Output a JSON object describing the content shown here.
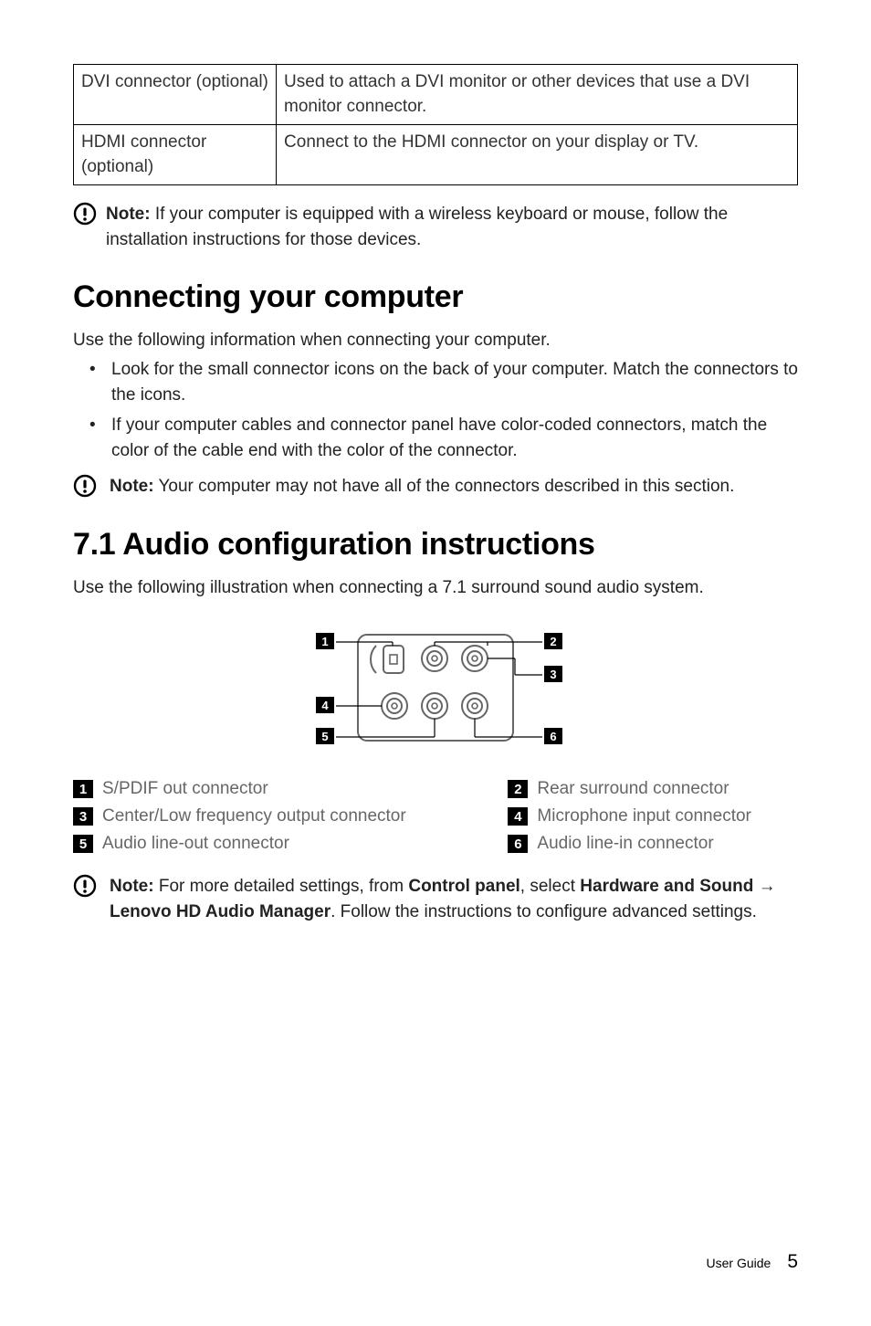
{
  "table": {
    "rows": [
      {
        "c1": "DVI connector (optional)",
        "c2": "Used to attach a DVI monitor or other devices that use a DVI monitor connector."
      },
      {
        "c1": "HDMI connector (optional)",
        "c2": "Connect to the HDMI connector on your display or TV."
      }
    ]
  },
  "notes": {
    "note1": {
      "label": "Note:",
      "body": " If your computer is equipped with a wireless keyboard or mouse, follow the installation instructions for those devices."
    },
    "note2": {
      "label": "Note:",
      "body": " Your computer may not have all of the connectors described in this section."
    },
    "note3": {
      "label": "Note:",
      "body_pre": " For more detailed settings, from ",
      "cp": "Control panel",
      "mid": ", select ",
      "hs": "Hardware and Sound",
      "arrow": " → ",
      "mgr": "Lenovo HD Audio Manager",
      "tail": ". Follow the instructions to configure advanced settings."
    }
  },
  "sections": {
    "connecting": {
      "title": "Connecting your computer",
      "intro": "Use the following information when connecting your computer.",
      "bullets": [
        "Look for the small connector icons on the back of your computer. Match the connectors to the icons.",
        "If your computer cables and connector panel have color-coded connectors, match the color of the cable end with the color of the connector."
      ]
    },
    "audio": {
      "title": "7.1 Audio configuration instructions",
      "intro": "Use the following illustration when connecting a 7.1 surround sound audio system."
    }
  },
  "legend": [
    {
      "n": "1",
      "t": "S/PDIF out connector"
    },
    {
      "n": "2",
      "t": "Rear surround connector"
    },
    {
      "n": "3",
      "t": "Center/Low frequency output connector"
    },
    {
      "n": "4",
      "t": "Microphone input connector"
    },
    {
      "n": "5",
      "t": "Audio line-out connector"
    },
    {
      "n": "6",
      "t": "Audio line-in connector"
    }
  ],
  "diagram_callouts": {
    "c1": "1",
    "c2": "2",
    "c3": "3",
    "c4": "4",
    "c5": "5",
    "c6": "6"
  },
  "footer": {
    "doc": "User Guide",
    "page": "5"
  }
}
